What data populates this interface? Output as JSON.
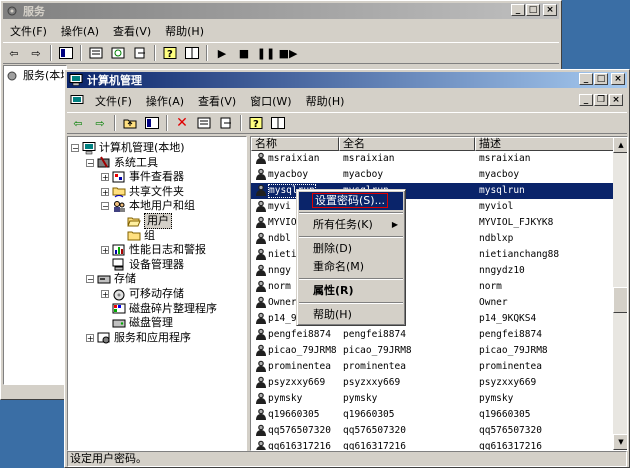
{
  "services_window": {
    "title": "服务",
    "menu": [
      "文件(F)",
      "操作(A)",
      "查看(V)",
      "帮助(H)"
    ],
    "tree_root": "服务(本地)"
  },
  "mgmt_window": {
    "title": "计算机管理",
    "menu": [
      "文件(F)",
      "操作(A)",
      "查看(V)",
      "窗口(W)",
      "帮助(H)"
    ],
    "tree": [
      {
        "label": "计算机管理(本地)",
        "level": 0,
        "expander": "minus",
        "icon": "computer-icon"
      },
      {
        "label": "系统工具",
        "level": 1,
        "expander": "minus",
        "icon": "tools-icon"
      },
      {
        "label": "事件查看器",
        "level": 2,
        "expander": "plus",
        "icon": "event-viewer-icon"
      },
      {
        "label": "共享文件夹",
        "level": 2,
        "expander": "plus",
        "icon": "shared-folder-icon"
      },
      {
        "label": "本地用户和组",
        "level": 2,
        "expander": "minus",
        "icon": "users-groups-icon"
      },
      {
        "label": "用户",
        "level": 3,
        "expander": "none",
        "icon": "folder-open-icon",
        "selected": true
      },
      {
        "label": "组",
        "level": 3,
        "expander": "none",
        "icon": "folder-icon"
      },
      {
        "label": "性能日志和警报",
        "level": 2,
        "expander": "plus",
        "icon": "perf-log-icon"
      },
      {
        "label": "设备管理器",
        "level": 2,
        "expander": "none",
        "icon": "device-manager-icon"
      },
      {
        "label": "存储",
        "level": 1,
        "expander": "minus",
        "icon": "storage-icon"
      },
      {
        "label": "可移动存储",
        "level": 2,
        "expander": "plus",
        "icon": "removable-storage-icon"
      },
      {
        "label": "磁盘碎片整理程序",
        "level": 2,
        "expander": "none",
        "icon": "defrag-icon"
      },
      {
        "label": "磁盘管理",
        "level": 2,
        "expander": "none",
        "icon": "disk-management-icon"
      },
      {
        "label": "服务和应用程序",
        "level": 1,
        "expander": "plus",
        "icon": "services-apps-icon"
      }
    ],
    "columns": [
      "名称",
      "全名",
      "描述"
    ],
    "rows": [
      [
        "msraixian",
        "msraixian",
        "msraixian"
      ],
      [
        "myacboy",
        "myacboy",
        "myacboy"
      ],
      [
        "mysqlrun",
        "mysqlrun",
        "mysqlrun"
      ],
      [
        "myviol",
        "",
        "myviol"
      ],
      [
        "MYVIOL_FJKYK8",
        "8",
        "MYVIOL_FJKYK8"
      ],
      [
        "ndblxp",
        "",
        "ndblxp"
      ],
      [
        "nietianchang88",
        "88",
        "nietianchang88"
      ],
      [
        "nngydz10",
        "",
        "nngydz10"
      ],
      [
        "norm",
        "",
        "norm"
      ],
      [
        "Owner",
        "",
        "Owner"
      ],
      [
        "p14_9KQKS4",
        "",
        "p14_9KQKS4"
      ],
      [
        "pengfei8874",
        "pengfei8874",
        "pengfei8874"
      ],
      [
        "picao_79JRM8",
        "picao_79JRM8",
        "picao_79JRM8"
      ],
      [
        "prominentea",
        "prominentea",
        "prominentea"
      ],
      [
        "psyzxxy669",
        "psyzxxy669",
        "psyzxxy669"
      ],
      [
        "pymsky",
        "pymsky",
        "pymsky"
      ],
      [
        "q19660305",
        "q19660305",
        "q19660305"
      ],
      [
        "qq576507320",
        "qq576507320",
        "qq576507320"
      ],
      [
        "qq616317216",
        "qq616317216",
        "qq616317216"
      ]
    ],
    "row_display_names": [
      "msraixian",
      "myacboy",
      "mysqlrun",
      "myvi",
      "MYVIO",
      "ndbl",
      "nieti",
      "nngy",
      "norm",
      "Owner",
      "p14_9",
      "pengfei8874",
      "picao_79JRM8",
      "prominentea",
      "psyzxxy669",
      "pymsky",
      "q19660305",
      "qq576507320",
      "qq616317216"
    ],
    "selected_row": 2,
    "status": "设定用户密码。"
  },
  "context_menu": {
    "items": [
      {
        "label": "设置密码(S)...",
        "highlighted": true
      },
      {
        "sep": true
      },
      {
        "label": "所有任务(K)",
        "submenu": true
      },
      {
        "sep": true
      },
      {
        "label": "删除(D)"
      },
      {
        "label": "重命名(M)"
      },
      {
        "sep": true
      },
      {
        "label": "属性(R)",
        "bold": true
      },
      {
        "sep": true
      },
      {
        "label": "帮助(H)"
      }
    ]
  }
}
